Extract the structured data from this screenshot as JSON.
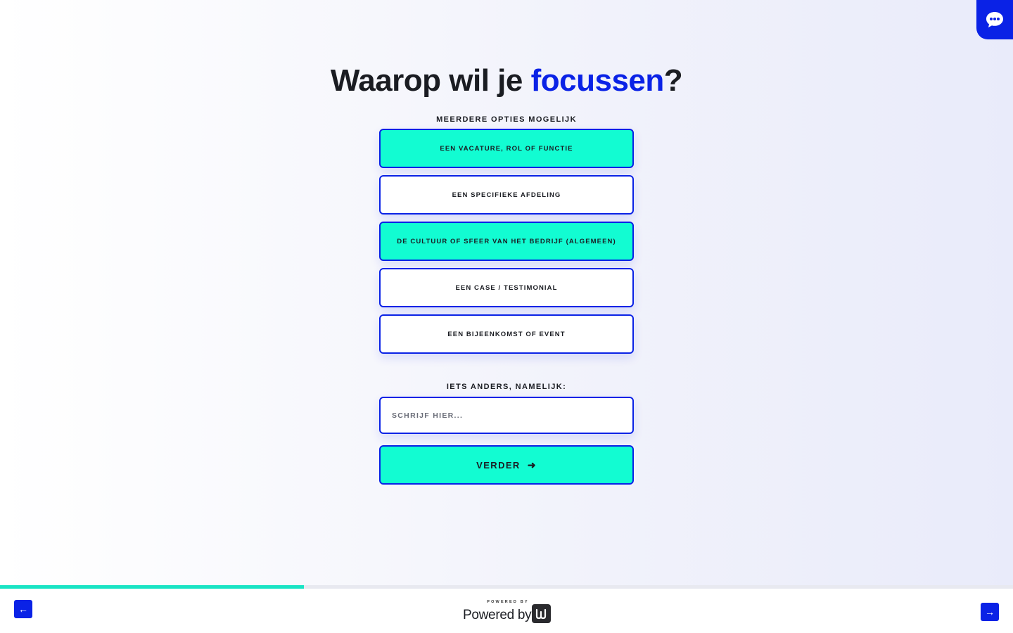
{
  "chat": {
    "icon": "chat-bubble-icon"
  },
  "question": {
    "title_prefix": "Waarop wil je ",
    "title_accent": "focussen",
    "title_suffix": "?",
    "subtitle": "MEERDERE OPTIES MOGELIJK"
  },
  "options": [
    {
      "label": "EEN VACATURE, ROL OF FUNCTIE",
      "selected": true
    },
    {
      "label": "EEN SPECIFIEKE AFDELING",
      "selected": false
    },
    {
      "label": "DE CULTUUR OF SFEER VAN HET BEDRIJF (ALGEMEEN)",
      "selected": true
    },
    {
      "label": "EEN CASE / TESTIMONIAL",
      "selected": false
    },
    {
      "label": "EEN BIJEENKOMST OF EVENT",
      "selected": false
    }
  ],
  "other": {
    "label": "IETS ANDERS, NAMELIJK:",
    "placeholder": "SCHRIJF HIER...",
    "value": ""
  },
  "next_button": {
    "label": "VERDER",
    "icon": "arrow-right-icon"
  },
  "progress": {
    "fraction": 0.3
  },
  "footer": {
    "prev_icon": "arrow-left-icon",
    "next_icon": "arrow-right-icon",
    "powered_small": "POWERED BY",
    "powered_main": "Powered by"
  },
  "colors": {
    "accent": "#0a22e6",
    "selected": "#12fcd2",
    "progress": "#19e4c4"
  }
}
